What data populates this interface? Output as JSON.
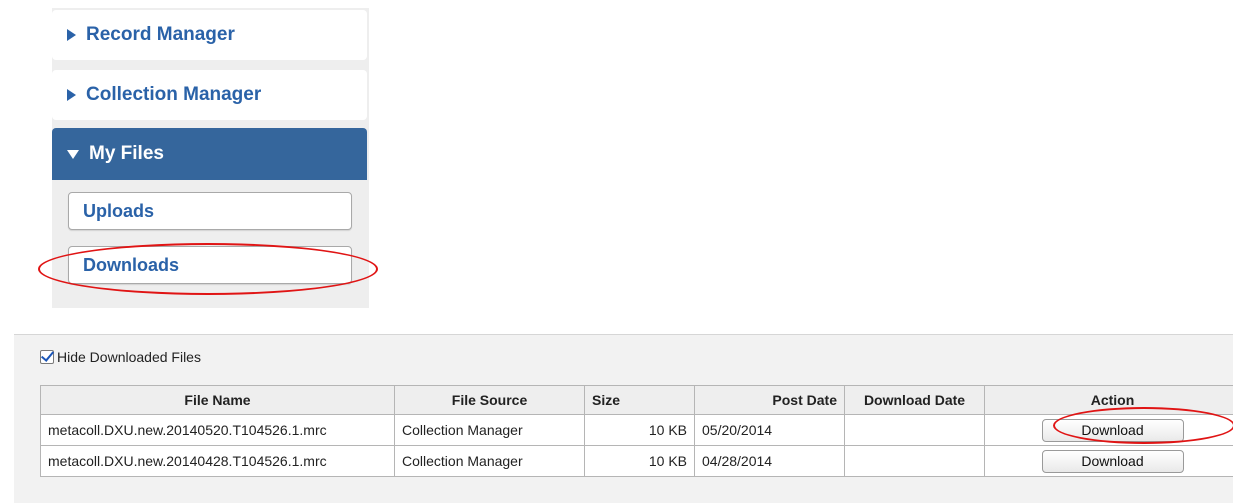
{
  "sidebar": {
    "items": [
      {
        "label": "Record Manager",
        "expanded": false
      },
      {
        "label": "Collection Manager",
        "expanded": false
      },
      {
        "label": "My Files",
        "expanded": true
      }
    ],
    "subitems": [
      {
        "label": "Uploads"
      },
      {
        "label": "Downloads"
      }
    ]
  },
  "files": {
    "hide_downloaded_label": "Hide Downloaded Files",
    "hide_downloaded_checked": true,
    "columns": [
      "File Name",
      "File Source",
      "Size",
      "Post Date",
      "Download Date",
      "Action"
    ],
    "rows": [
      {
        "file_name": "metacoll.DXU.new.20140520.T104526.1.mrc",
        "file_source": "Collection Manager",
        "size": "10 KB",
        "post_date": "05/20/2014",
        "download_date": "",
        "action_label": "Download"
      },
      {
        "file_name": "metacoll.DXU.new.20140428.T104526.1.mrc",
        "file_source": "Collection Manager",
        "size": "10 KB",
        "post_date": "04/28/2014",
        "download_date": "",
        "action_label": "Download"
      }
    ]
  },
  "colors": {
    "link_blue": "#2a62a8",
    "active_nav_bg": "#35669c",
    "annotation_red": "#e01414"
  }
}
